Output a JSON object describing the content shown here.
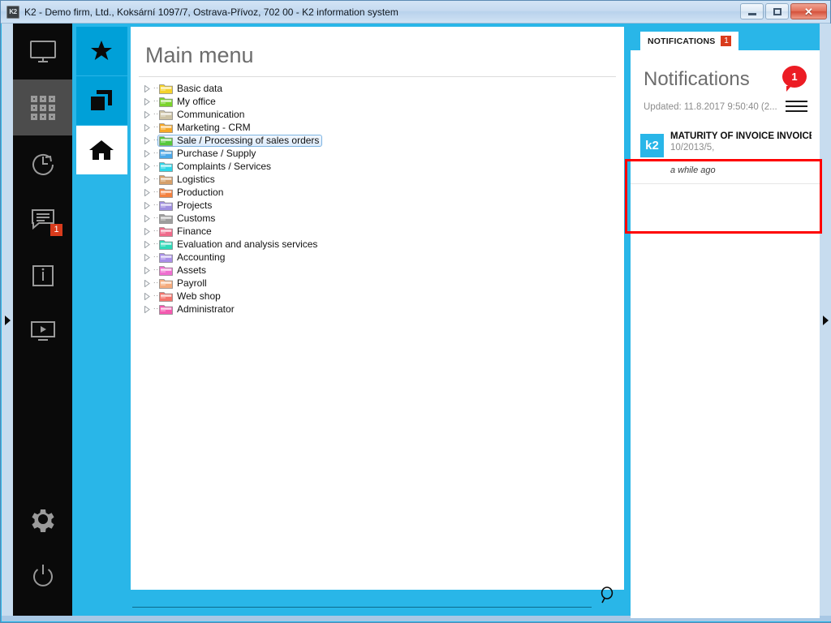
{
  "window": {
    "title": "K2 - Demo firm, Ltd., Koksární 1097/7, Ostrava-Přívoz, 702 00 - K2 information system",
    "app_icon_text": "K2",
    "minimize_label": "Minimize",
    "maximize_label": "Maximize",
    "close_label": "✕"
  },
  "colors": {
    "accent_cyan": "#29b6e8",
    "nav_blue": "#00a0d8",
    "badge_red": "#d93b1c",
    "bubble_red": "#ec1c24",
    "rail_black": "#0a0a0a",
    "rail_active": "#4c4c4c",
    "highlight_red": "#ff0000"
  },
  "rail": {
    "items": [
      {
        "icon": "monitor-icon",
        "name": "rail-item-desktop",
        "active": false,
        "badge": null
      },
      {
        "icon": "grid-apps-icon",
        "name": "rail-item-apps",
        "active": true,
        "badge": null
      },
      {
        "icon": "history-clock-icon",
        "name": "rail-item-history",
        "active": false,
        "badge": null
      },
      {
        "icon": "messages-icon",
        "name": "rail-item-messages",
        "active": false,
        "badge": "1"
      },
      {
        "icon": "info-icon",
        "name": "rail-item-info",
        "active": false,
        "badge": null
      },
      {
        "icon": "media-play-icon",
        "name": "rail-item-media",
        "active": false,
        "badge": null
      }
    ],
    "bottom_items": [
      {
        "icon": "gear-icon",
        "name": "rail-item-settings"
      },
      {
        "icon": "power-icon",
        "name": "rail-item-power"
      }
    ]
  },
  "navcol": {
    "items": [
      {
        "icon": "star-icon",
        "name": "nav-item-favorites",
        "active": false
      },
      {
        "icon": "windows-stack-icon",
        "name": "nav-item-open-windows",
        "active": false
      },
      {
        "icon": "home-icon",
        "name": "nav-item-home",
        "active": true
      }
    ]
  },
  "main": {
    "title": "Main menu",
    "tree": [
      {
        "label": "Basic data",
        "color": "#f5d22c",
        "selected": false
      },
      {
        "label": "My office",
        "color": "#7bd42b",
        "selected": false
      },
      {
        "label": "Communication",
        "color": "#cdc3a5",
        "selected": false
      },
      {
        "label": "Marketing - CRM",
        "color": "#f7a825",
        "selected": false
      },
      {
        "label": "Sale / Processing of sales orders",
        "color": "#55c83c",
        "selected": true
      },
      {
        "label": "Purchase / Supply",
        "color": "#4aa8e8",
        "selected": false
      },
      {
        "label": "Complaints / Services",
        "color": "#2dd6e8",
        "selected": false
      },
      {
        "label": "Logistics",
        "color": "#d6a06a",
        "selected": false
      },
      {
        "label": "Production",
        "color": "#f4813f",
        "selected": false
      },
      {
        "label": "Projects",
        "color": "#9f8fe0",
        "selected": false
      },
      {
        "label": "Customs",
        "color": "#9d9d9d",
        "selected": false
      },
      {
        "label": "Finance",
        "color": "#f06a8a",
        "selected": false
      },
      {
        "label": "Evaluation and analysis services",
        "color": "#2fd9b8",
        "selected": false
      },
      {
        "label": "Accounting",
        "color": "#a98fe8",
        "selected": false
      },
      {
        "label": "Assets",
        "color": "#ef6fd0",
        "selected": false
      },
      {
        "label": "Payroll",
        "color": "#f5ab7d",
        "selected": false
      },
      {
        "label": "Web shop",
        "color": "#f4736c",
        "selected": false
      },
      {
        "label": "Administrator",
        "color": "#f45ab0",
        "selected": false
      }
    ]
  },
  "search": {
    "value": "",
    "placeholder": "",
    "icon": "magnifier-icon"
  },
  "notifications": {
    "tab_label": "NOTIFICATIONS",
    "tab_badge": "1",
    "panel_title": "Notifications",
    "count_badge": "1",
    "updated_text": "Updated: 11.8.2017 9:50:40 (2...",
    "menu_icon": "hamburger-menu-icon",
    "items": [
      {
        "avatar": "k2",
        "title": "MATURITY OF INVOICE INVOICES O...",
        "subtitle": "10/2013/5,",
        "time": "a while ago"
      }
    ]
  },
  "edges": {
    "left_expander": "expand-left-panel",
    "right_expander": "expand-right-panel"
  }
}
